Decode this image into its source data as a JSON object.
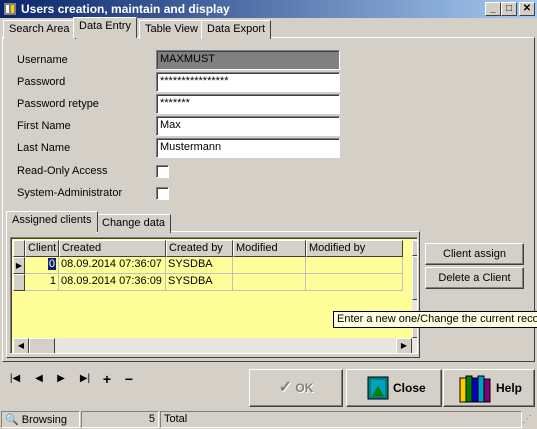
{
  "window": {
    "title": "Users creation, maintain and display",
    "minimize_glyph": "_",
    "maximize_glyph": "□",
    "close_glyph": "✕"
  },
  "top_tabs": [
    "Search Area",
    "Data Entry",
    "Table View",
    "Data Export"
  ],
  "form": {
    "username_label": "Username",
    "username_value": "MAXMUST",
    "password_label": "Password",
    "password_value": "****************",
    "password_retype_label": "Password retype",
    "password_retype_value": "*******",
    "first_name_label": "First Name",
    "first_name_value": "Max",
    "last_name_label": "Last Name",
    "last_name_value": "Mustermann",
    "read_only_label": "Read-Only Access",
    "read_only_checked": false,
    "sysadmin_label": "System-Administrator",
    "sysadmin_checked": false
  },
  "sub_tabs": [
    "Assigned clients",
    "Change data"
  ],
  "grid": {
    "columns": [
      "Client",
      "Created",
      "Created by",
      "Modified",
      "Modified by"
    ],
    "rows": [
      {
        "client": "0",
        "created": "08.09.2014 07:36:07",
        "created_by": "SYSDBA",
        "modified": "",
        "modified_by": ""
      },
      {
        "client": "1",
        "created": "08.09.2014 07:36:09",
        "created_by": "SYSDBA",
        "modified": "",
        "modified_by": ""
      }
    ],
    "current_row_glyph": "▶"
  },
  "side_buttons": {
    "client_assign": "Client assign",
    "delete_client": "Delete a Client"
  },
  "tooltip": "Enter a new one/Change the current reco",
  "navigator": {
    "first_glyph": "|◀",
    "prior_glyph": "◀",
    "next_glyph": "▶",
    "last_glyph": "▶|",
    "insert_glyph": "+",
    "delete_glyph": "−"
  },
  "bottom_buttons": {
    "ok": "OK",
    "close": "Close",
    "help": "Help"
  },
  "status_bar": {
    "mode": "Browsing",
    "count": "5",
    "label": "Total"
  },
  "colors": {
    "title_bar": "#0a246a",
    "grid_background": "#ffff99",
    "selection": "#0a246a",
    "window_face": "#d4d0c8"
  }
}
